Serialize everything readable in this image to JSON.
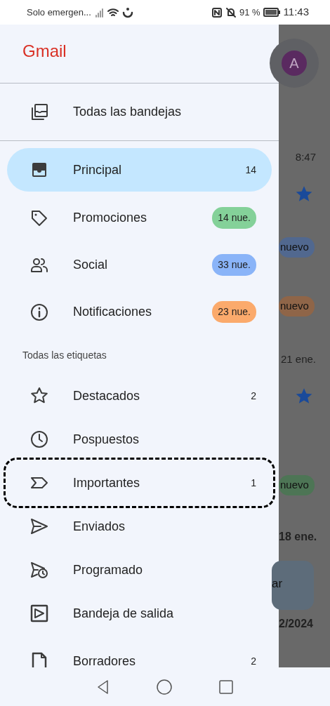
{
  "status_bar": {
    "carrier": "Solo emergen...",
    "battery": "91 %",
    "time": "11:43"
  },
  "drawer": {
    "title": "Gmail",
    "top_item": {
      "label": "Todas las bandejas"
    },
    "categories": [
      {
        "label": "Principal",
        "selected": true,
        "count": "14"
      },
      {
        "label": "Promociones",
        "selected": false,
        "badge": "14 nue.",
        "color": "#84d199"
      },
      {
        "label": "Social",
        "selected": false,
        "badge": "33 nue.",
        "color": "#8ab4f8"
      },
      {
        "label": "Notificaciones",
        "selected": false,
        "badge": "23 nue.",
        "color": "#fbaa6c"
      }
    ],
    "section_header": "Todas las etiquetas",
    "labels": [
      {
        "label": "Destacados",
        "count": "2",
        "outlined": false
      },
      {
        "label": "Pospuestos",
        "outlined": false
      },
      {
        "label": "Importantes",
        "count": "1",
        "outlined": true
      },
      {
        "label": "Enviados",
        "outlined": false
      },
      {
        "label": "Programado",
        "outlined": false
      },
      {
        "label": "Bandeja de salida",
        "outlined": false
      },
      {
        "label": "Borradores",
        "count": "2",
        "outlined": false
      }
    ]
  },
  "background": {
    "avatar": "A",
    "items": [
      {
        "kind": "time",
        "text": "8:47"
      },
      {
        "kind": "star"
      },
      {
        "kind": "chip",
        "text": "nuevo",
        "color": "#51688f"
      },
      {
        "kind": "chip",
        "text": "nuevo",
        "color": "#8f6548"
      },
      {
        "kind": "time",
        "text": "21 ene."
      },
      {
        "kind": "star"
      },
      {
        "kind": "chip",
        "text": "nuevo",
        "color": "#4d7555"
      },
      {
        "kind": "date",
        "text": "18 ene."
      },
      {
        "kind": "fab",
        "text": "ar"
      },
      {
        "kind": "date",
        "text": "2/2024"
      }
    ]
  }
}
